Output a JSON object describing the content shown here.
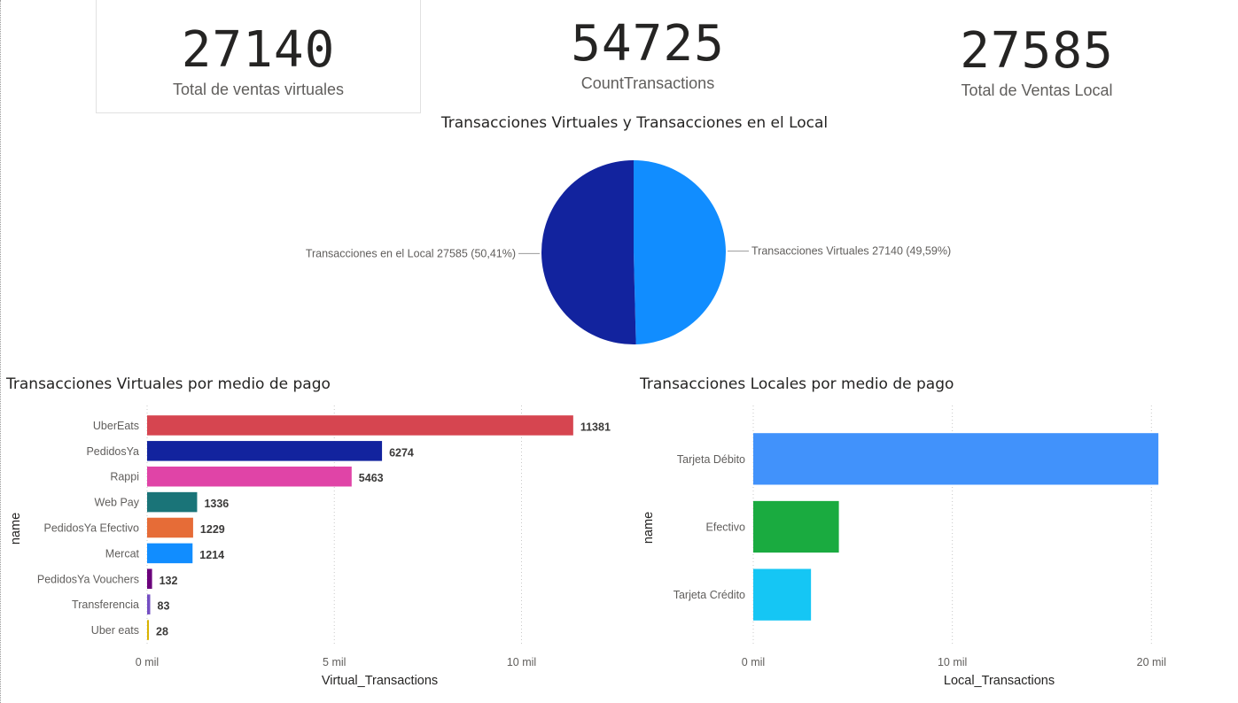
{
  "kpis": [
    {
      "value": "27140",
      "label": "Total de ventas virtuales"
    },
    {
      "value": "54725",
      "label": "CountTransactions"
    },
    {
      "value": "27585",
      "label": "Total de Ventas Local"
    }
  ],
  "chart_data": [
    {
      "type": "pie",
      "title": "Transacciones Virtuales y Transacciones en el Local",
      "slices": [
        {
          "label": "Transacciones Virtuales",
          "value": 27140,
          "percent": "49,59%",
          "display": "Transacciones Virtuales 27140 (49,59%)",
          "color": "#118dff"
        },
        {
          "label": "Transacciones en el Local",
          "value": 27585,
          "percent": "50,41%",
          "display": "Transacciones en el Local 27585 (50,41%)",
          "color": "#12239e"
        }
      ]
    },
    {
      "type": "bar",
      "orientation": "horizontal",
      "title": "Transacciones Virtuales por medio de pago",
      "xlabel": "Virtual_Transactions",
      "ylabel": "name",
      "xlim": [
        0,
        12000
      ],
      "xticks": [
        {
          "value": 0,
          "label": "0 mil"
        },
        {
          "value": 5000,
          "label": "5 mil"
        },
        {
          "value": 10000,
          "label": "10 mil"
        }
      ],
      "categories": [
        "UberEats",
        "PedidosYa",
        "Rappi",
        "Web Pay",
        "PedidosYa Efectivo",
        "Mercat",
        "PedidosYa Vouchers",
        "Transferencia",
        "Uber eats"
      ],
      "values": [
        11381,
        6274,
        5463,
        1336,
        1229,
        1214,
        132,
        83,
        28
      ],
      "colors": [
        "#d64550",
        "#12239e",
        "#e044a7",
        "#1a7478",
        "#e66c37",
        "#118dff",
        "#6b007b",
        "#744ec2",
        "#d9b300"
      ],
      "data_labels": true
    },
    {
      "type": "bar",
      "orientation": "horizontal",
      "title": "Transacciones Locales por medio de pago",
      "xlabel": "Local_Transactions",
      "ylabel": "name",
      "xlim": [
        0,
        21500
      ],
      "xticks": [
        {
          "value": 0,
          "label": "0 mil"
        },
        {
          "value": 10000,
          "label": "10 mil"
        },
        {
          "value": 20000,
          "label": "20 mil"
        }
      ],
      "categories": [
        "Tarjeta Débito",
        "Efectivo",
        "Tarjeta Crédito"
      ],
      "values": [
        20350,
        4300,
        2900
      ],
      "colors": [
        "#4192fb",
        "#1aab40",
        "#15c6f4"
      ],
      "data_labels": false
    }
  ]
}
